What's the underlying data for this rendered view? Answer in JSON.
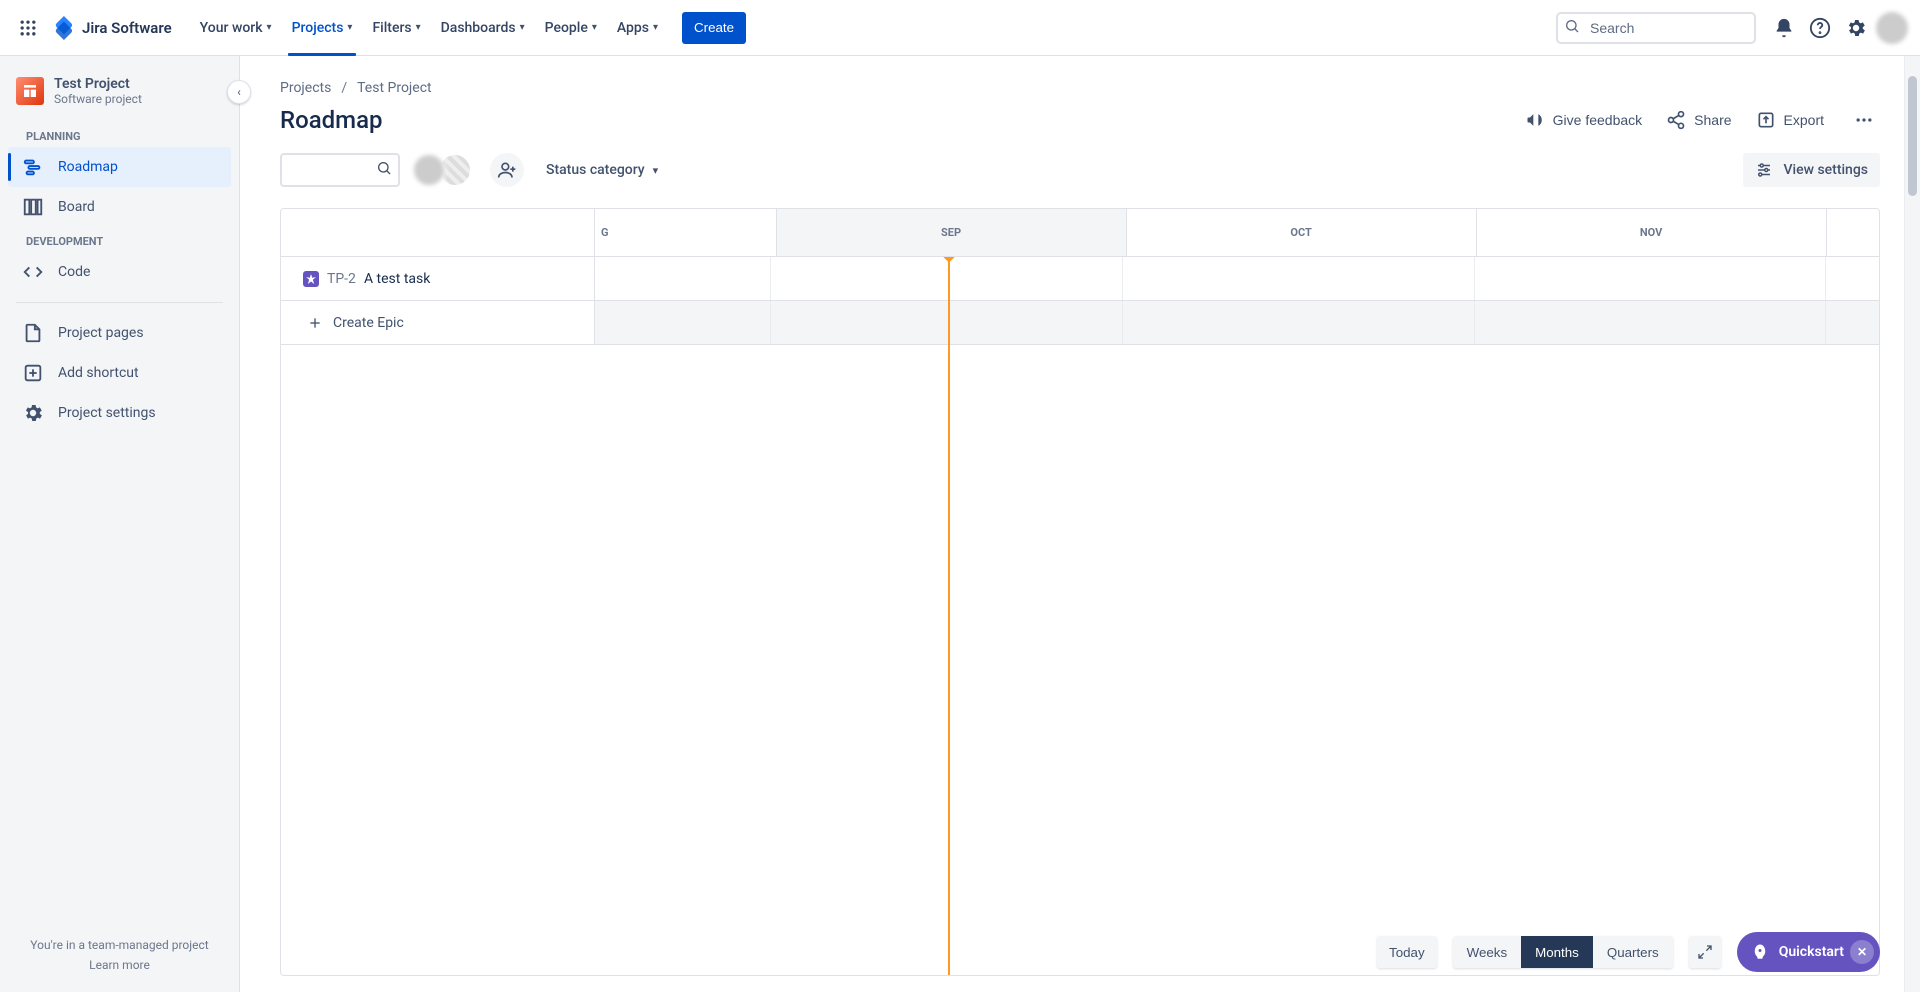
{
  "topnav": {
    "logo_text": "Jira Software",
    "items": [
      {
        "label": "Your work"
      },
      {
        "label": "Projects",
        "active": true
      },
      {
        "label": "Filters"
      },
      {
        "label": "Dashboards"
      },
      {
        "label": "People"
      },
      {
        "label": "Apps"
      }
    ],
    "create_label": "Create",
    "search_placeholder": "Search"
  },
  "sidebar": {
    "project_name": "Test Project",
    "project_sub": "Software project",
    "section_planning": "PLANNING",
    "section_dev": "DEVELOPMENT",
    "items_planning": [
      {
        "label": "Roadmap",
        "selected": true
      },
      {
        "label": "Board"
      }
    ],
    "items_dev": [
      {
        "label": "Code"
      }
    ],
    "items_other": [
      {
        "label": "Project pages"
      },
      {
        "label": "Add shortcut"
      },
      {
        "label": "Project settings"
      }
    ],
    "foot_text": "You're in a team-managed project",
    "foot_link": "Learn more"
  },
  "crumbs": {
    "a": "Projects",
    "b": "Test Project"
  },
  "page_title": "Roadmap",
  "title_actions": {
    "feedback": "Give feedback",
    "share": "Share",
    "export": "Export"
  },
  "toolbar": {
    "status_label": "Status category",
    "view_settings": "View settings"
  },
  "roadmap": {
    "months": [
      "G",
      "SEP",
      "OCT",
      "NOV",
      ""
    ],
    "tasks": [
      {
        "key": "TP-2",
        "title": "A test task"
      }
    ],
    "create_epic": "Create Epic"
  },
  "bottom": {
    "today": "Today",
    "segments": [
      "Weeks",
      "Months",
      "Quarters"
    ],
    "segment_active": 1
  },
  "quickstart_label": "Quickstart"
}
